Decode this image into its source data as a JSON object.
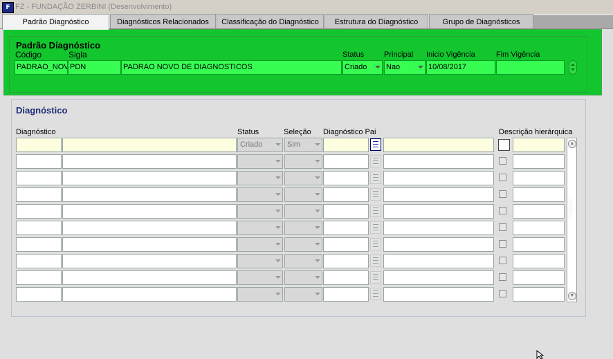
{
  "window": {
    "title": "FZ - FUNDAÇÃO ZERBINI (Desenvolvimento)",
    "icon": "form-icon"
  },
  "tabs": [
    {
      "label": "Padrão Diagnóstico",
      "active": true
    },
    {
      "label": "Diagnósticos Relacionados",
      "active": false
    },
    {
      "label": "Classificação do Diagnóstico",
      "active": false
    },
    {
      "label": "Estrutura do Diagnóstico",
      "active": false
    },
    {
      "label": "Grupo de Diagnósticos",
      "active": false
    }
  ],
  "master": {
    "title": "Padrão Diagnóstico",
    "labels": {
      "codigo": "Código",
      "sigla": "Sigla",
      "status": "Status",
      "principal": "Principal",
      "inicio": "Inicio Vigência",
      "fim": "Fim Vigência"
    },
    "values": {
      "codigo": "PADRAO_NOV",
      "sigla": "PDN",
      "descricao": "PADRAO NOVO DE DIAGNOSTICOS",
      "status": "Criado",
      "principal": "Nao",
      "inicio": "10/08/2017",
      "fim": ""
    },
    "color": "#13c62e"
  },
  "detail": {
    "title": "Diagnóstico",
    "labels": {
      "diagnostico": "Diagnóstico",
      "status": "Status",
      "selecao": "Seleção",
      "pai": "Diagnóstico Pai",
      "hier": "Descrição hierárquica"
    },
    "first_row": {
      "status": "Criado",
      "selecao": "Sim"
    },
    "row_count": 10
  }
}
